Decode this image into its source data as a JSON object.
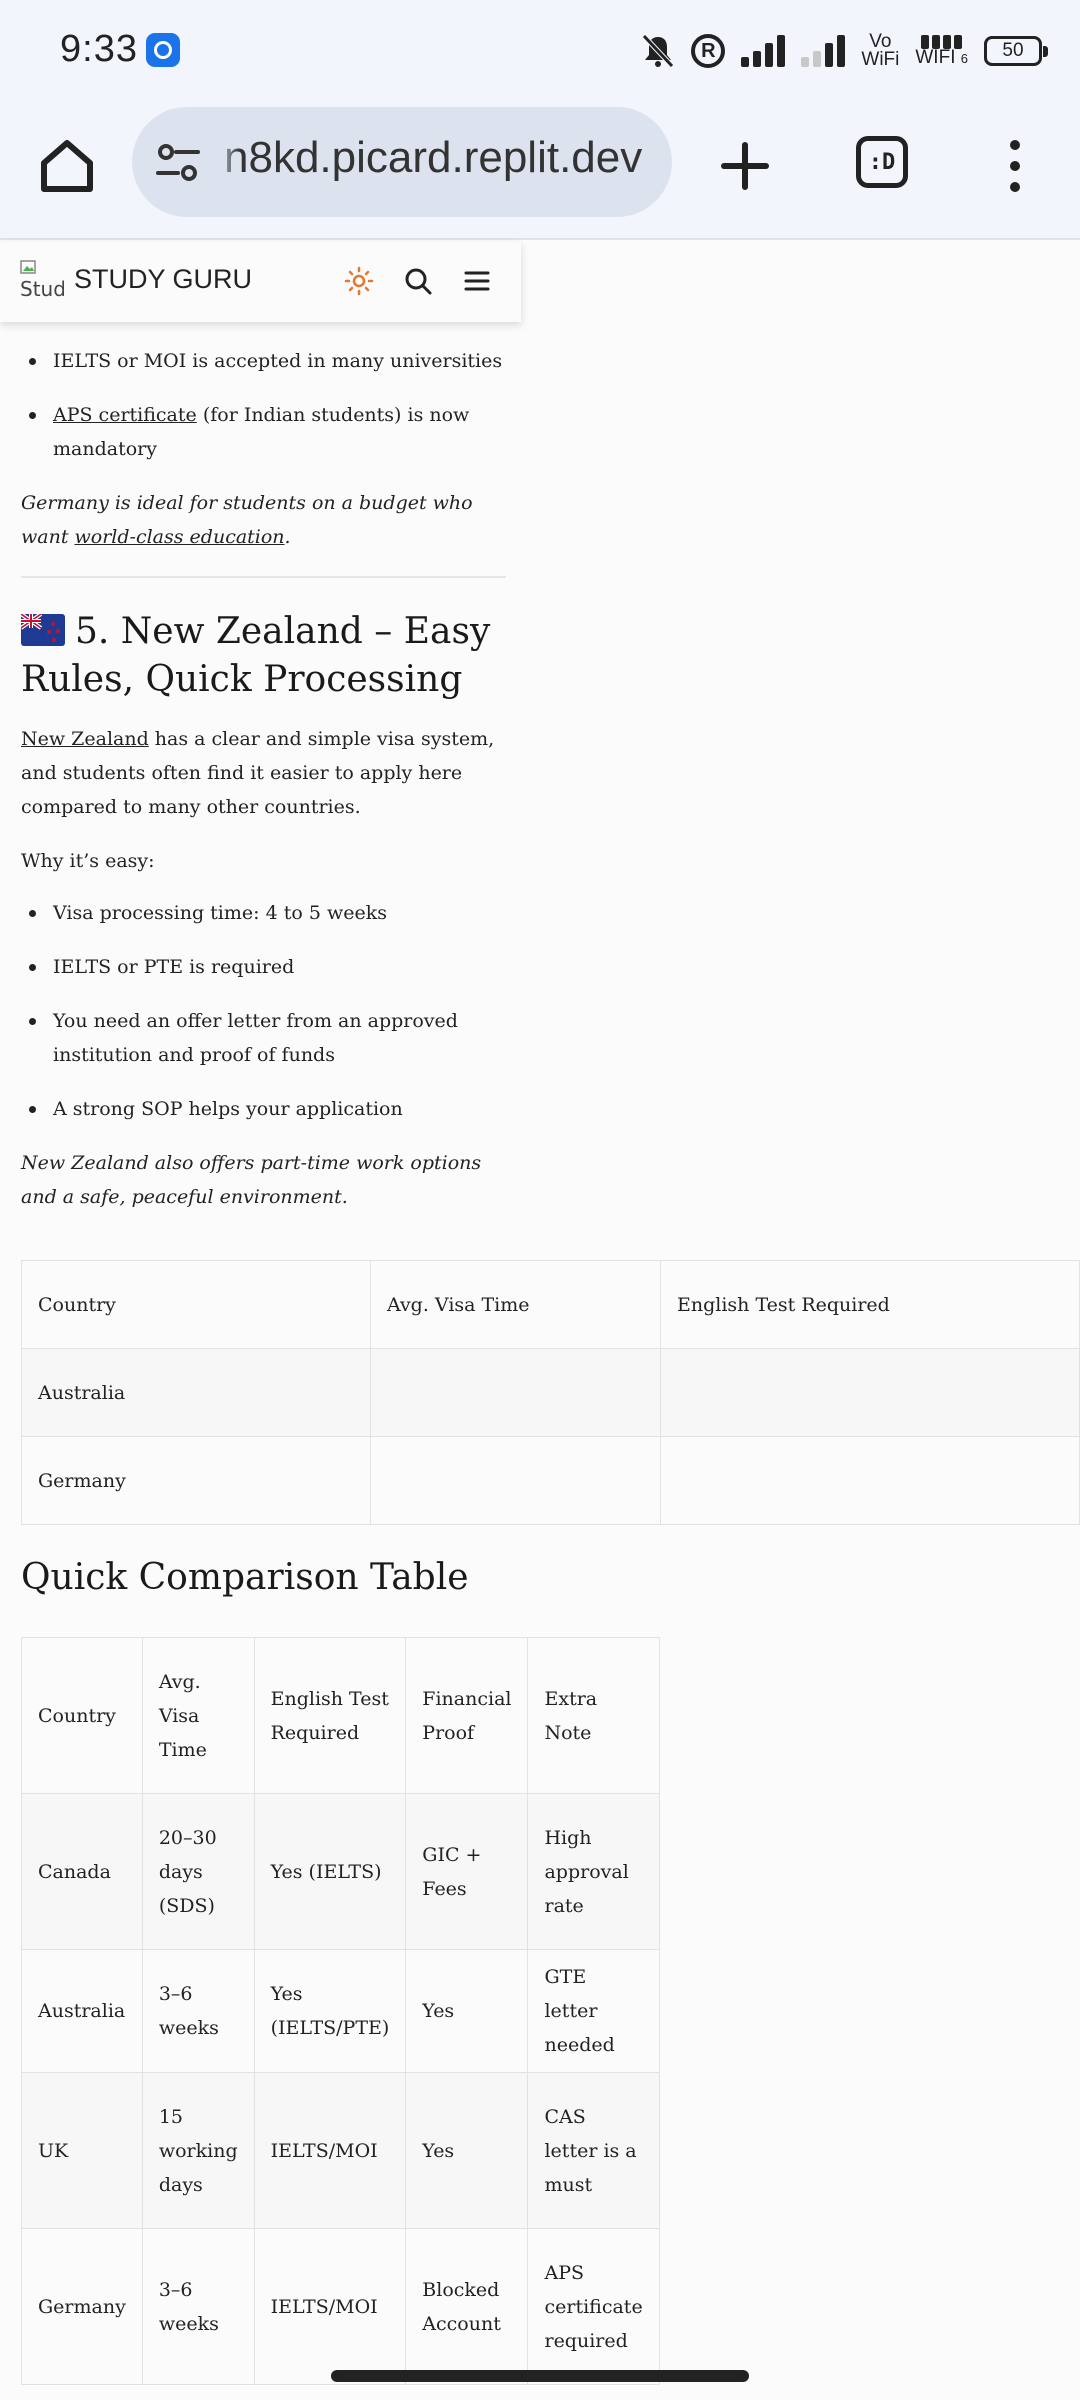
{
  "status_bar": {
    "time": "9:33",
    "battery": "50",
    "volte_top": "Vo",
    "volte_bottom": "WiFi",
    "wifi_label": "WIFI",
    "wifi_sub": "6"
  },
  "browser": {
    "url": "n8kd.picard.replit.dev",
    "tabs_label": ":D"
  },
  "site": {
    "logo_alt": "Stud",
    "brand": "STUDY GURU"
  },
  "germany_section": {
    "bullets": [
      "IELTS or MOI is accepted in many universities",
      "(for Indian students) is now mandatory"
    ],
    "aps_link": "APS certificate",
    "closing_prefix": "Germany is ideal for students on a budget who want ",
    "closing_link": "world-class education",
    "closing_suffix": "."
  },
  "nz_section": {
    "heading": "5. New Zealand – Easy Rules, Quick Processing",
    "intro_link": "New Zealand",
    "intro_rest": " has a clear and simple visa system, and students often find it easier to apply here compared to many other countries.",
    "why_label": "Why it’s easy:",
    "bullets": [
      "Visa processing time: 4 to 5 weeks",
      "IELTS or PTE is required",
      "You need an offer letter from an approved institution and proof of funds",
      "A strong SOP helps your application"
    ],
    "closing": "New Zealand also offers part-time work options and a safe, peaceful environment."
  },
  "partial_table": {
    "headers": [
      "Country",
      "Avg. Visa Time",
      "English Test Required"
    ],
    "rows": [
      [
        "Australia",
        "",
        ""
      ],
      [
        "Germany",
        "",
        ""
      ]
    ]
  },
  "comparison": {
    "title": "Quick Comparison Table",
    "headers": [
      "Country",
      "Avg. Visa Time",
      "English Test Required",
      "Financial Proof",
      "Extra Note"
    ],
    "rows": [
      [
        "Canada",
        "20–30 days (SDS)",
        "Yes (IELTS)",
        "GIC + Fees",
        "High approval rate"
      ],
      [
        "Australia",
        "3–6 weeks",
        "Yes (IELTS/PTE)",
        "Yes",
        "GTE letter needed"
      ],
      [
        "UK",
        "15 working days",
        "IELTS/MOI",
        "Yes",
        "CAS letter is a must"
      ],
      [
        "Germany",
        "3–6 weeks",
        "IELTS/MOI",
        "Blocked Account",
        "APS certificate required"
      ]
    ]
  },
  "colors": {
    "chrome_bg": "#f2f5fc",
    "url_pill": "#dde3ee",
    "page_bg": "#fbfbfb",
    "sun_icon": "#e8762c",
    "text": "#222222"
  }
}
